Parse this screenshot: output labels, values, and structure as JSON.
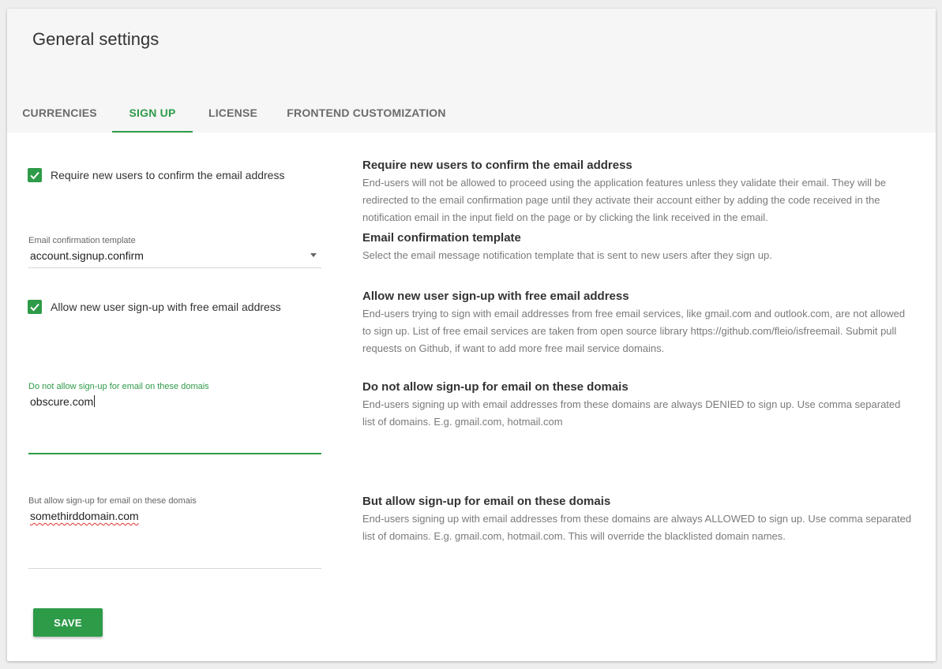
{
  "header": {
    "title": "General settings"
  },
  "tabs": [
    {
      "label": "CURRENCIES",
      "active": false
    },
    {
      "label": "SIGN UP",
      "active": true
    },
    {
      "label": "LICENSE",
      "active": false
    },
    {
      "label": "FRONTEND CUSTOMIZATION",
      "active": false
    }
  ],
  "form": {
    "confirm_email": {
      "label": "Require new users to confirm the email address",
      "checked": true
    },
    "template": {
      "label": "Email confirmation template",
      "value": "account.signup.confirm"
    },
    "free_email": {
      "label": "Allow new user sign-up with free email address",
      "checked": true
    },
    "deny_domains": {
      "label": "Do not allow sign-up for email on these domais",
      "value": "obscure.com"
    },
    "allow_domains": {
      "label": "But allow sign-up for email on these domais",
      "value": "somethirddomain.com"
    },
    "save_label": "SAVE"
  },
  "descriptions": {
    "confirm_email": {
      "title": "Require new users to confirm the email address",
      "text": "End-users will not be allowed to proceed using the application features unless they validate their email. They will be redirected to the email confirmation page until they activate their account either by adding the code received in the notification email in the input field on the page or by clicking the link received in the email."
    },
    "template": {
      "title": "Email confirmation template",
      "text": "Select the email message notification template that is sent to new users after they sign up."
    },
    "free_email": {
      "title": "Allow new user sign-up with free email address",
      "text": "End-users trying to sign with email addresses from free email services, like gmail.com and outlook.com, are not allowed to sign up. List of free email services are taken from open source library https://github.com/fleio/isfreemail. Submit pull requests on Github, if want to add more free mail service domains."
    },
    "deny_domains": {
      "title": "Do not allow sign-up for email on these domais",
      "text": "End-users signing up with email addresses from these domains are always DENIED to sign up. Use comma separated list of domains. E.g. gmail.com, hotmail.com"
    },
    "allow_domains": {
      "title": "But allow sign-up for email on these domais",
      "text": "End-users signing up with email addresses from these domains are always ALLOWED to sign up. Use comma separated list of domains. E.g. gmail.com, hotmail.com. This will override the blacklisted domain names."
    }
  },
  "colors": {
    "accent": "#2e9b48",
    "header_bg": "#f6f6f6",
    "page_bg": "#eeeeee"
  },
  "icons": {
    "checkbox": "check-icon",
    "dropdown": "chevron-down-icon"
  }
}
